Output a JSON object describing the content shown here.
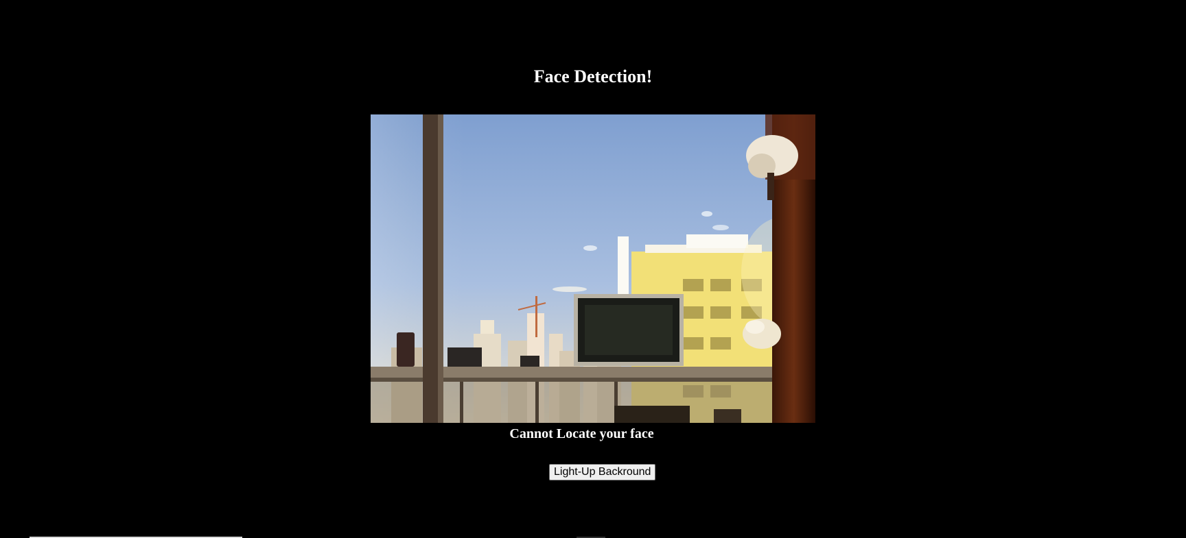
{
  "page": {
    "title": "Face Detection!",
    "status": "Cannot Locate your face",
    "button_label": "Light-Up Backround"
  },
  "camera": {
    "icon": "camera-feed-image"
  },
  "colors": {
    "background": "#000000",
    "text": "#ffffff",
    "button_bg": "#efefef"
  }
}
